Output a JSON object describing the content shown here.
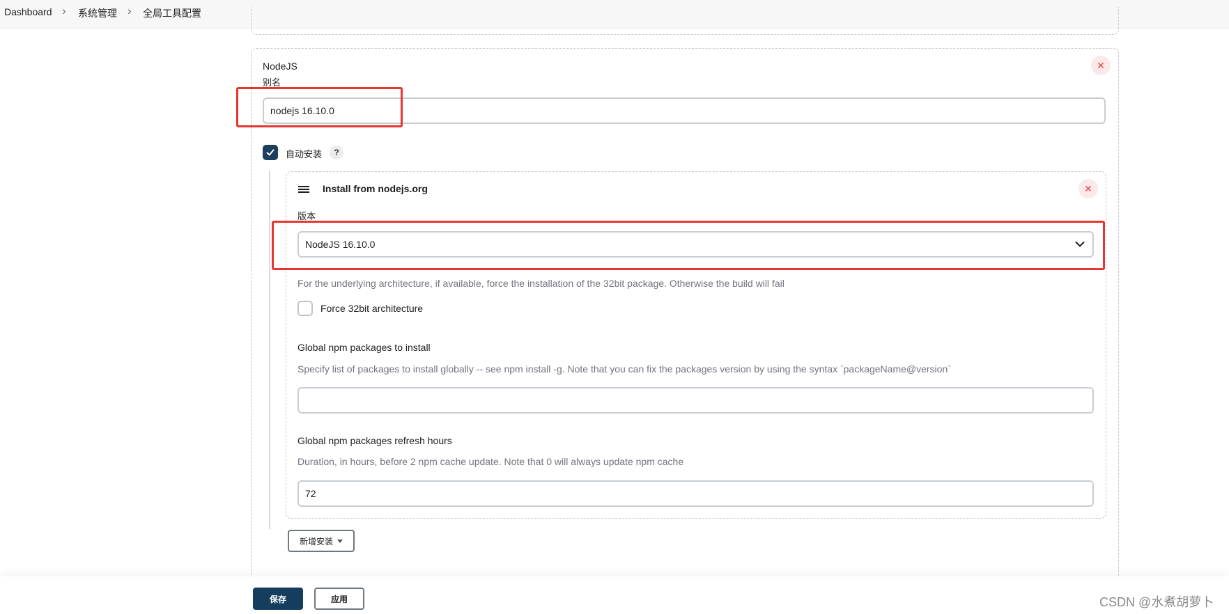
{
  "breadcrumb": {
    "items": [
      "Dashboard",
      "系统管理",
      "全局工具配置"
    ],
    "separator": ">"
  },
  "nodejs_section": {
    "title": "NodeJS",
    "alias_label": "别名",
    "alias_value": "nodejs 16.10.0",
    "remove_icon": "close-icon"
  },
  "auto_install": {
    "label": "自动安装",
    "checked": true,
    "help": "?"
  },
  "installer": {
    "title": "Install from nodejs.org",
    "drag_icon": "hamburger-icon",
    "version_label": "版本",
    "version_value": "NodeJS 16.10.0",
    "arch_description": "For the underlying architecture, if available, force the installation of the 32bit package. Otherwise the build will fail",
    "force32_label": "Force 32bit architecture",
    "force32_checked": false,
    "npm_packages_label": "Global npm packages to install",
    "npm_packages_description": "Specify list of packages to install globally -- see npm install -g. Note that you can fix the packages version by using the syntax `packageName@version`",
    "npm_packages_value": "",
    "refresh_label": "Global npm packages refresh hours",
    "refresh_description": "Duration, in hours, before 2 npm cache update. Note that 0 will always update npm cache",
    "refresh_value": "72"
  },
  "add_installer_label": "新增安装",
  "footer": {
    "save_label": "保存",
    "apply_label": "应用"
  },
  "watermark": "CSDN @水煮胡萝卜",
  "colors": {
    "primary": "#143d5e",
    "highlight": "#e8352f",
    "remove": "#e2424b"
  }
}
